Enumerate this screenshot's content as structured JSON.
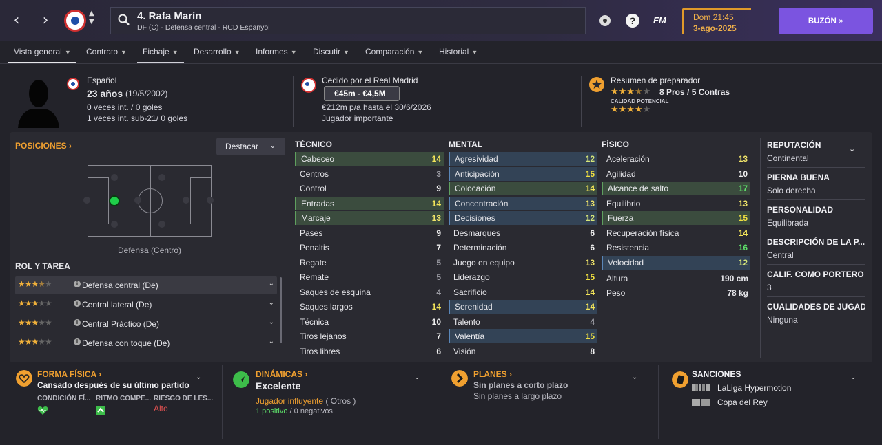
{
  "topbar": {
    "back_icon": "chevron-left-icon",
    "forward_icon": "chevron-right-icon",
    "player_title": "4. Rafa Marín",
    "player_subtitle": "DF (C) - Defensa central - RCD Espanyol",
    "fm_label": "FM",
    "day_time": "Dom 21:45",
    "date": "3-ago-2025",
    "inbox_label": "BUZÓN"
  },
  "tabs": [
    {
      "label": "Vista general"
    },
    {
      "label": "Contrato"
    },
    {
      "label": "Fichaje"
    },
    {
      "label": "Desarrollo"
    },
    {
      "label": "Informes"
    },
    {
      "label": "Discutir"
    },
    {
      "label": "Comparación"
    },
    {
      "label": "Historial"
    }
  ],
  "header": {
    "nationality": "Español",
    "age": "23 años",
    "dob": "(19/5/2002)",
    "caps": "0 veces int. / 0 goles",
    "caps_u21": "1 veces int. sub-21/ 0 goles",
    "loan_text": "Cedido por el Real Madrid",
    "value": "€45m - €4,5M",
    "wage": "€212m p/a hasta el 30/6/2026",
    "squad_status": "Jugador importante",
    "coach_summary": "Resumen de preparador",
    "pros_cons": "8 Pros / 5 Contras",
    "potential_label": "CALIDAD POTENCIAL",
    "current_ability_stars": 3.5,
    "potential_stars": 4
  },
  "positions": {
    "title": "POSICIONES",
    "dropdown": "Destacar",
    "position_label": "Defensa (Centro)",
    "roles_title": "ROL Y TAREA",
    "roles": [
      {
        "label": "Defensa central (De)",
        "stars": 3.5
      },
      {
        "label": "Central lateral (De)",
        "stars": 3
      },
      {
        "label": "Central Práctico (De)",
        "stars": 3
      },
      {
        "label": "Defensa con toque (De)",
        "stars": 3
      }
    ]
  },
  "attributes": {
    "technical_title": "TÉCNICO",
    "mental_title": "MENTAL",
    "physical_title": "FÍSICO",
    "technical": [
      {
        "name": "Cabeceo",
        "value": "14",
        "hl": "g"
      },
      {
        "name": "Centros",
        "value": "3",
        "hl": ""
      },
      {
        "name": "Control",
        "value": "9",
        "hl": ""
      },
      {
        "name": "Entradas",
        "value": "14",
        "hl": "g"
      },
      {
        "name": "Marcaje",
        "value": "13",
        "hl": "g"
      },
      {
        "name": "Pases",
        "value": "9",
        "hl": ""
      },
      {
        "name": "Penaltis",
        "value": "7",
        "hl": ""
      },
      {
        "name": "Regate",
        "value": "5",
        "hl": ""
      },
      {
        "name": "Remate",
        "value": "5",
        "hl": ""
      },
      {
        "name": "Saques de esquina",
        "value": "4",
        "hl": ""
      },
      {
        "name": "Saques largos",
        "value": "14",
        "hl": ""
      },
      {
        "name": "Técnica",
        "value": "10",
        "hl": ""
      },
      {
        "name": "Tiros lejanos",
        "value": "7",
        "hl": ""
      },
      {
        "name": "Tiros libres",
        "value": "6",
        "hl": ""
      }
    ],
    "mental": [
      {
        "name": "Agresividad",
        "value": "12",
        "hl": "b"
      },
      {
        "name": "Anticipación",
        "value": "15",
        "hl": "b"
      },
      {
        "name": "Colocación",
        "value": "14",
        "hl": "g"
      },
      {
        "name": "Concentración",
        "value": "13",
        "hl": "b"
      },
      {
        "name": "Decisiones",
        "value": "12",
        "hl": "b"
      },
      {
        "name": "Desmarques",
        "value": "6",
        "hl": ""
      },
      {
        "name": "Determinación",
        "value": "6",
        "hl": ""
      },
      {
        "name": "Juego en equipo",
        "value": "13",
        "hl": ""
      },
      {
        "name": "Liderazgo",
        "value": "15",
        "hl": ""
      },
      {
        "name": "Sacrificio",
        "value": "14",
        "hl": ""
      },
      {
        "name": "Serenidad",
        "value": "14",
        "hl": "b"
      },
      {
        "name": "Talento",
        "value": "4",
        "hl": ""
      },
      {
        "name": "Valentía",
        "value": "15",
        "hl": "b"
      },
      {
        "name": "Visión",
        "value": "8",
        "hl": ""
      }
    ],
    "physical": [
      {
        "name": "Aceleración",
        "value": "13",
        "hl": ""
      },
      {
        "name": "Agilidad",
        "value": "10",
        "hl": ""
      },
      {
        "name": "Alcance de salto",
        "value": "17",
        "hl": "g"
      },
      {
        "name": "Equilibrio",
        "value": "13",
        "hl": ""
      },
      {
        "name": "Fuerza",
        "value": "15",
        "hl": "g"
      },
      {
        "name": "Recuperación física",
        "value": "14",
        "hl": ""
      },
      {
        "name": "Resistencia",
        "value": "16",
        "hl": ""
      },
      {
        "name": "Velocidad",
        "value": "12",
        "hl": "b"
      }
    ],
    "height_label": "Altura",
    "height": "190 cm",
    "weight_label": "Peso",
    "weight": "78 kg"
  },
  "side": [
    {
      "title": "REPUTACIÓN",
      "value": "Continental"
    },
    {
      "title": "PIERNA BUENA",
      "value": "Solo derecha"
    },
    {
      "title": "PERSONALIDAD",
      "value": "Equilibrada"
    },
    {
      "title": "DESCRIPCIÓN DE LA P...",
      "value": "Central"
    },
    {
      "title": "CALIF. COMO PORTERO",
      "value": "3"
    },
    {
      "title": "CUALIDADES DE JUGADO",
      "value": "Ninguna"
    }
  ],
  "bottom": {
    "fitness_title": "FORMA FÍSICA",
    "fitness_text": "Cansado después de su último partido",
    "fit_cols": [
      "CONDICIÓN FÍ...",
      "RITMO COMPE...",
      "RIESGO DE LES..."
    ],
    "injury_risk": "Alto",
    "dynamics_title": "DINÁMICAS",
    "dynamics_value": "Excelente",
    "influence": "Jugador influyente",
    "influence_group": "( Otros )",
    "positives": "1 positivo",
    "slash": "/",
    "negatives": "0 negativos",
    "plans_title": "PLANES",
    "plans_short": "Sin planes a corto plazo",
    "plans_long": "Sin planes a largo plazo",
    "sanctions_title": "SANCIONES",
    "comp1": "LaLiga Hypermotion",
    "comp2": "Copa del Rey"
  },
  "colors": {
    "accent": "#7b54e0",
    "orange": "#f0a030",
    "green": "#1fcf4a"
  }
}
